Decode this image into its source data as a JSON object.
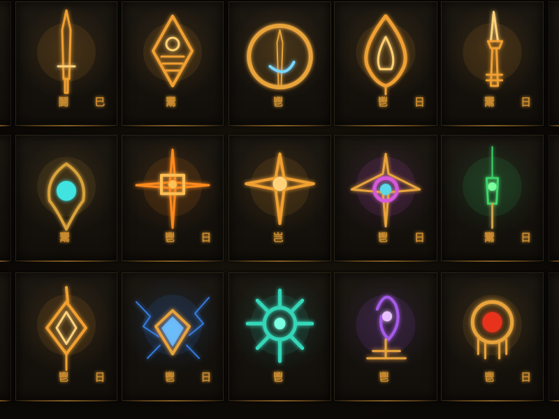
{
  "theme": {
    "background": "#0b0906",
    "card_border": "#2a2418",
    "gold": "#e8a33a",
    "gold_bright": "#ffd27a"
  },
  "cards": [
    {
      "icon": "golden-sword-icon",
      "glow": "#f0a032",
      "core": "#ffd27a",
      "runes": [
        "鬪",
        "巳"
      ]
    },
    {
      "icon": "golden-shield-crest-icon",
      "glow": "#f0a032",
      "core": "#ffcf70",
      "runes": [
        "鬻"
      ]
    },
    {
      "icon": "ring-with-blade-icon",
      "glow": "#e8a33a",
      "core": "#7ad7ff",
      "runes": [
        "鬯"
      ]
    },
    {
      "icon": "flame-drop-icon",
      "glow": "#f0a032",
      "core": "#ffcf70",
      "runes": [
        "鬯",
        "日"
      ]
    },
    {
      "icon": "ornate-dagger-icon",
      "glow": "#f0a032",
      "core": "#ffd27a",
      "runes": [
        "鬻",
        "日"
      ]
    },
    {
      "icon": "teal-orb-crest-icon",
      "glow": "#d9a23a",
      "core": "#3fe3e0",
      "runes": [
        "鬻"
      ]
    },
    {
      "icon": "radiant-cross-sun-icon",
      "glow": "#ff8a1e",
      "core": "#ffbf52",
      "runes": [
        "鬯",
        "日"
      ]
    },
    {
      "icon": "four-point-star-icon",
      "glow": "#f0a032",
      "core": "#ffd27a",
      "runes": [
        "岂"
      ]
    },
    {
      "icon": "magenta-orb-cross-icon",
      "glow": "#d65ad8",
      "core": "#5ad7e8",
      "runes": [
        "鬯",
        "日"
      ]
    },
    {
      "icon": "green-spear-icon",
      "glow": "#3dd46a",
      "core": "#7dffa0",
      "runes": [
        "鬻",
        "日"
      ]
    },
    {
      "icon": "golden-diamond-sword-icon",
      "glow": "#f0a032",
      "core": "#ffd27a",
      "runes": [
        "鬯",
        "日"
      ]
    },
    {
      "icon": "blue-lightning-gem-icon",
      "glow": "#3a8cff",
      "core": "#6fc0ff",
      "runes": [
        "鬯",
        "日"
      ]
    },
    {
      "icon": "cyan-spiked-orb-icon",
      "glow": "#35d6b8",
      "core": "#7affe0",
      "runes": [
        "鬯"
      ]
    },
    {
      "icon": "violet-spirit-altar-icon",
      "glow": "#a55ae8",
      "core": "#e8c0ff",
      "runes": [
        "鬯"
      ]
    },
    {
      "icon": "red-orb-medallion-icon",
      "glow": "#e8a33a",
      "core": "#e8321e",
      "runes": [
        "鬯",
        "日"
      ]
    }
  ],
  "edge_runes": [
    "日",
    "日",
    "日"
  ]
}
